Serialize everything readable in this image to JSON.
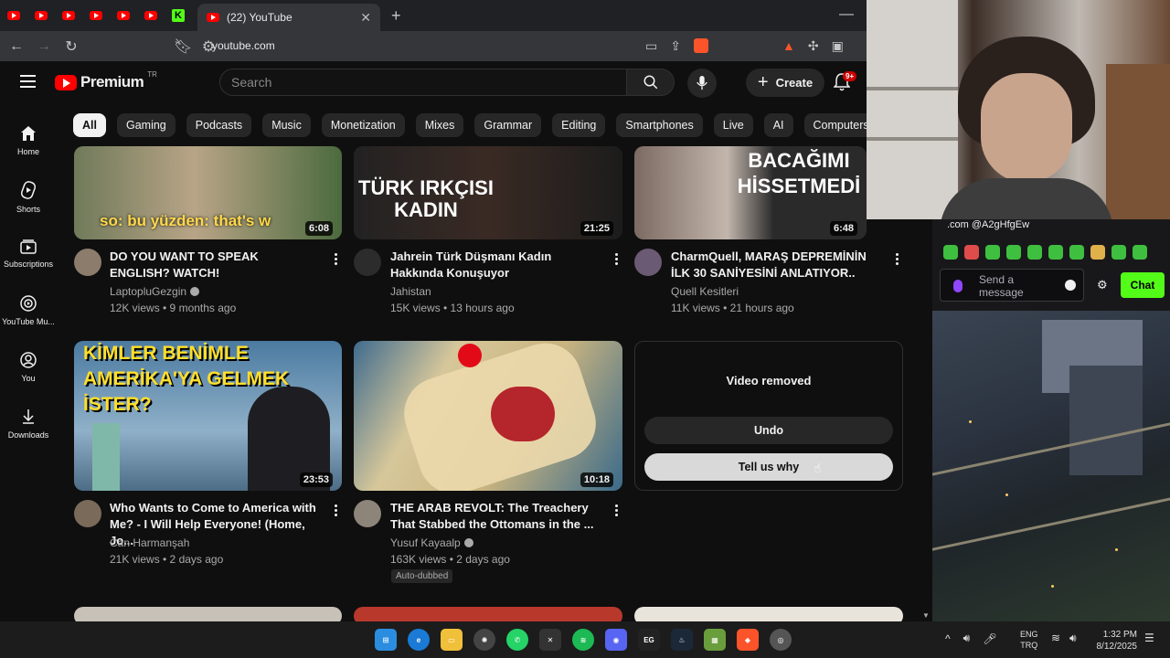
{
  "browser": {
    "active_tab_title": "(22) YouTube",
    "url": "youtube.com"
  },
  "youtube": {
    "logo_text": "Premium",
    "country_code": "TR",
    "search_placeholder": "Search",
    "create_label": "Create",
    "notification_badge": "9+",
    "chips": [
      "All",
      "Gaming",
      "Podcasts",
      "Music",
      "Monetization",
      "Mixes",
      "Grammar",
      "Editing",
      "Smartphones",
      "Live",
      "AI",
      "Computers"
    ],
    "guide": [
      {
        "label": "Home",
        "icon": "home-icon"
      },
      {
        "label": "Shorts",
        "icon": "shorts-icon"
      },
      {
        "label": "Subscriptions",
        "icon": "subscriptions-icon"
      },
      {
        "label": "YouTube Mu...",
        "icon": "youtube-music-icon"
      },
      {
        "label": "You",
        "icon": "you-icon"
      },
      {
        "label": "Downloads",
        "icon": "downloads-icon"
      }
    ],
    "videos": [
      {
        "thumb_caption": "so: bu yüzden: that's w",
        "duration": "6:08",
        "title": "DO YOU WANT TO SPEAK ENGLISH? WATCH!",
        "channel": "LaptopluGezgin",
        "stats": "12K views • 9 months ago"
      },
      {
        "thumb_caption": "TÜRK IRKÇISI KADIN",
        "duration": "21:25",
        "title": "Jahrein Türk Düşmanı Kadın Hakkında Konuşuyor",
        "channel": "Jahistan",
        "stats": "15K views • 13 hours ago"
      },
      {
        "thumb_caption": "BACAĞIMI HİSSETMEDİ",
        "duration": "6:48",
        "title": "CharmQuell, MARAŞ DEPREMİNİN İLK 30 SANİYESİNİ ANLATIYOR..",
        "channel": "Quell Kesitleri",
        "stats": "11K views • 21 hours ago"
      },
      {
        "thumb_caption": "KİMLER BENİMLE AMERİKA'YA GELMEK İSTER?",
        "duration": "23:53",
        "title": "Who Wants to Come to America with Me? - I Will Help Everyone! (Home, Jo...",
        "channel": "Can Harmanşah",
        "stats": "21K views • 2 days ago"
      },
      {
        "thumb_caption": "",
        "duration": "10:18",
        "title": "THE ARAB REVOLT: The Treachery That Stabbed the Ottomans in the ...",
        "channel": "Yusuf Kayaalp",
        "stats": "163K views • 2 days ago",
        "badge": "Auto-dubbed"
      }
    ],
    "removed": {
      "title": "Video removed",
      "undo": "Undo",
      "tell_us_why": "Tell us why"
    }
  },
  "chat": {
    "message": ".com @A2gHfgEw",
    "placeholder": "Send a message",
    "button": "Chat"
  },
  "taskbar": {
    "lang_top": "ENG",
    "lang_bottom": "TRQ",
    "time": "1:32 PM",
    "date": "8/12/2025"
  },
  "colors": {
    "yt_red": "#ff0000",
    "kick_green": "#53fc18",
    "brave_orange": "#fb542b"
  }
}
